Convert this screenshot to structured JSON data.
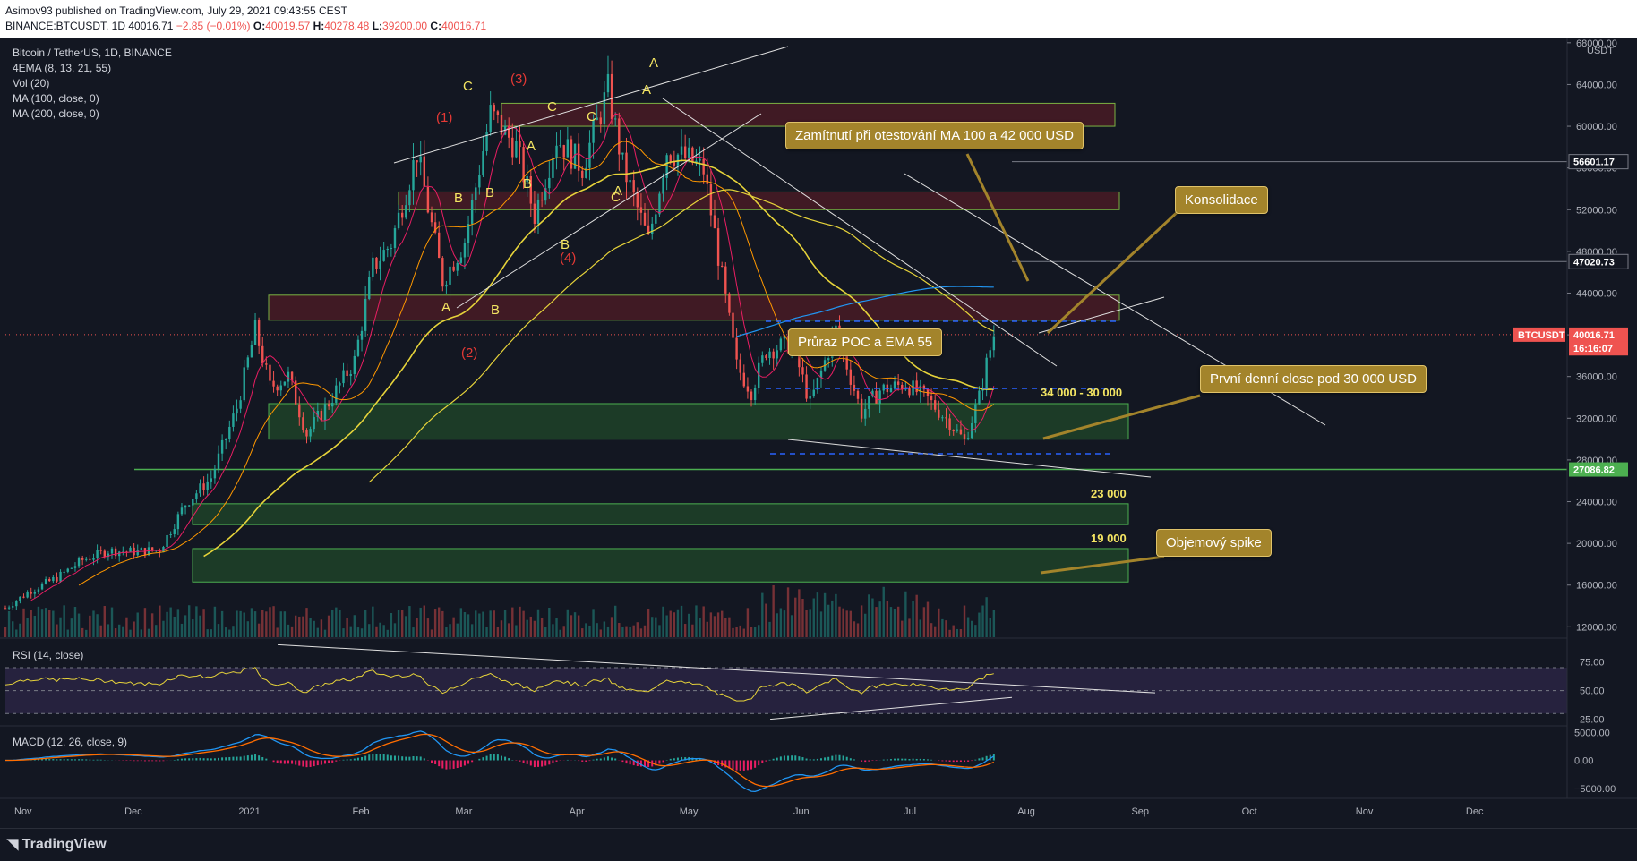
{
  "header": {
    "line1": "Asimov93 published on TradingView.com, July 29, 2021 09:43:55 CEST",
    "line2_symbol": "BINANCE:BTCUSDT, 1D",
    "line2_price": "40016.71",
    "line2_change": "−2.85 (−0.01%)",
    "o_label": "O:",
    "o": "40019.57",
    "h_label": "H:",
    "h": "40278.48",
    "l_label": "L:",
    "l": "39200.00",
    "c_label": "C:",
    "c": "40016.71"
  },
  "legend": {
    "title": "Bitcoin / TetherUS, 1D, BINANCE",
    "ema": "4EMA (8, 13, 21, 55)",
    "vol": "Vol (20)",
    "ma100": "MA (100, close, 0)",
    "ma200": "MA (200, close, 0)"
  },
  "callouts": {
    "rejection": "Zamítnutí při otestování MA 100 a 42 000 USD",
    "consolidation": "Konsolidace",
    "poc_break": "Průraz POC a EMA 55",
    "first_close": "První denní close pod 30 000 USD",
    "volume_spike": "Objemový spike"
  },
  "zone_labels": {
    "z1": "34 000 - 30 000",
    "z2": "23 000",
    "z3": "19 000"
  },
  "waves": [
    {
      "t": "(1)",
      "c": "red"
    },
    {
      "t": "(2)",
      "c": "red"
    },
    {
      "t": "(3)",
      "c": "red"
    },
    {
      "t": "(4)",
      "c": "red"
    },
    {
      "t": "A",
      "c": "yel"
    },
    {
      "t": "B",
      "c": "yel"
    },
    {
      "t": "C",
      "c": "yel"
    },
    {
      "t": "A",
      "c": "yel"
    },
    {
      "t": "B",
      "c": "yel"
    },
    {
      "t": "C",
      "c": "yel"
    },
    {
      "t": "A",
      "c": "yel"
    },
    {
      "t": "B",
      "c": "yel"
    },
    {
      "t": "C",
      "c": "yel"
    },
    {
      "t": "A",
      "c": "yel"
    },
    {
      "t": "B",
      "c": "yel"
    },
    {
      "t": "C",
      "c": "yel"
    },
    {
      "t": "A",
      "c": "yel"
    },
    {
      "t": "B",
      "c": "yel"
    }
  ],
  "rsi_label": "RSI (14, close)",
  "macd_label": "MACD (12, 26, close, 9)",
  "footer_logo": "TradingView",
  "colors": {
    "background": "#131722",
    "up": "#26a69a",
    "down": "#ef5350",
    "zone_green": "#1b5e20",
    "zone_red": "#5d1a1a",
    "ema_yellow": "#e6d33a",
    "ma_blue": "#2196f3",
    "price_tag": "#ef5350"
  },
  "chart_data": {
    "type": "candlestick",
    "symbol": "BTCUSDT",
    "price_axis": {
      "unit": "USDT",
      "ticks": [
        "68000.00",
        "64000.00",
        "60000.00",
        "56000.00",
        "52000.00",
        "48000.00",
        "44000.00",
        "40000.00",
        "36000.00",
        "32000.00",
        "28000.00",
        "24000.00",
        "20000.00",
        "16000.00",
        "12000.00"
      ],
      "range": [
        11000,
        68500
      ],
      "markers": [
        {
          "label": "56601.17",
          "value": 56601.17,
          "style": "dark"
        },
        {
          "label": "47020.73",
          "value": 47020.73,
          "style": "dark"
        },
        {
          "label": "BTCUSDT",
          "value": 40016.71,
          "style": "price"
        },
        {
          "label": "40016.71",
          "value": 40016.71,
          "style": "price"
        },
        {
          "label": "16:16:07",
          "value": 38700,
          "style": "price"
        },
        {
          "label": "27086.82",
          "value": 27086.82,
          "style": "green"
        }
      ]
    },
    "time_axis": {
      "ticks": [
        "Nov",
        "Dec",
        "2021",
        "Feb",
        "Mar",
        "Apr",
        "May",
        "Jun",
        "Jul",
        "Aug",
        "Sep",
        "Oct",
        "Nov",
        "Dec"
      ],
      "start": "2020-11-01",
      "end": "2021-12-31"
    },
    "closes": [
      [
        "2020-11-01",
        13800
      ],
      [
        "2020-11-08",
        15500
      ],
      [
        "2020-11-15",
        16700
      ],
      [
        "2020-11-22",
        18400
      ],
      [
        "2020-11-29",
        19300
      ],
      [
        "2020-12-06",
        19200
      ],
      [
        "2020-12-13",
        19400
      ],
      [
        "2020-12-20",
        23800
      ],
      [
        "2020-12-27",
        26300
      ],
      [
        "2021-01-03",
        33000
      ],
      [
        "2021-01-08",
        40500
      ],
      [
        "2021-01-12",
        35000
      ],
      [
        "2021-01-17",
        36000
      ],
      [
        "2021-01-22",
        30500
      ],
      [
        "2021-01-28",
        33500
      ],
      [
        "2021-02-04",
        37500
      ],
      [
        "2021-02-09",
        46500
      ],
      [
        "2021-02-14",
        48800
      ],
      [
        "2021-02-21",
        57500
      ],
      [
        "2021-02-28",
        45200
      ],
      [
        "2021-03-06",
        49000
      ],
      [
        "2021-03-13",
        61200
      ],
      [
        "2021-03-20",
        58000
      ],
      [
        "2021-03-25",
        51500
      ],
      [
        "2021-03-31",
        58900
      ],
      [
        "2021-04-07",
        56100
      ],
      [
        "2021-04-14",
        63500
      ],
      [
        "2021-04-18",
        56200
      ],
      [
        "2021-04-25",
        49000
      ],
      [
        "2021-04-30",
        57700
      ],
      [
        "2021-05-06",
        56800
      ],
      [
        "2021-05-10",
        55800
      ],
      [
        "2021-05-13",
        49700
      ],
      [
        "2021-05-19",
        37000
      ],
      [
        "2021-05-23",
        34600
      ],
      [
        "2021-05-27",
        38500
      ],
      [
        "2021-06-03",
        39200
      ],
      [
        "2021-06-08",
        33400
      ],
      [
        "2021-06-15",
        40500
      ],
      [
        "2021-06-22",
        32500
      ],
      [
        "2021-06-27",
        34700
      ],
      [
        "2021-07-04",
        35300
      ],
      [
        "2021-07-10",
        33800
      ],
      [
        "2021-07-16",
        31600
      ],
      [
        "2021-07-20",
        29800
      ],
      [
        "2021-07-24",
        34000
      ],
      [
        "2021-07-26",
        37200
      ],
      [
        "2021-07-28",
        40016
      ]
    ],
    "zones": [
      {
        "name": "resistance",
        "from": 60000,
        "to": 62200,
        "color": "red"
      },
      {
        "name": "resistance",
        "from": 52000,
        "to": 53700,
        "color": "red"
      },
      {
        "name": "resistance",
        "from": 41400,
        "to": 43800,
        "color": "red"
      },
      {
        "name": "34 000 - 30 000",
        "from": 30000,
        "to": 33400,
        "color": "green"
      },
      {
        "name": "23 000",
        "from": 21800,
        "to": 23800,
        "color": "green"
      },
      {
        "name": "19 000",
        "from": 16300,
        "to": 19500,
        "color": "green"
      }
    ],
    "rsi": {
      "ticks": [
        "75.00",
        "50.00",
        "25.00"
      ],
      "range": [
        20,
        95
      ],
      "last": 70
    },
    "macd": {
      "ticks": [
        "5000.00",
        "0.00",
        "−5000.00"
      ],
      "range": [
        -6000,
        6000
      ]
    }
  }
}
